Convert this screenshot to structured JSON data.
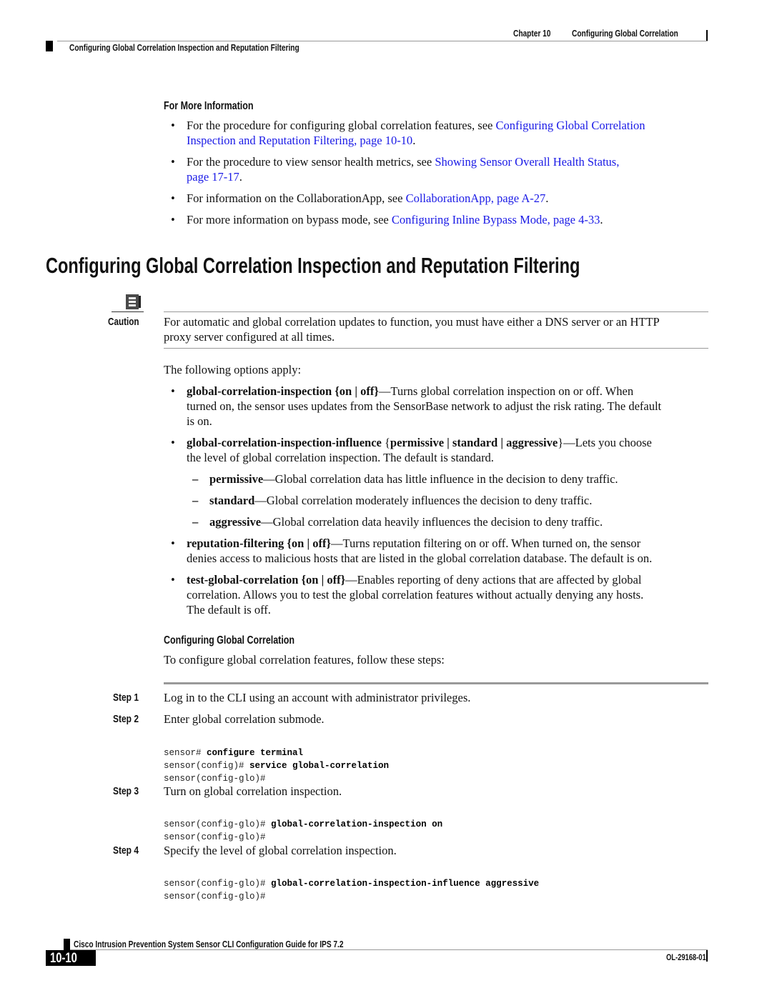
{
  "header": {
    "chapter_label": "Chapter 10",
    "chapter_title": "Configuring Global Correlation",
    "section_title": "Configuring Global Correlation Inspection and Reputation Filtering"
  },
  "more_info": {
    "heading": "For More Information",
    "items": [
      {
        "text": "For the procedure for configuring global correlation features, see ",
        "link": "Configuring Global Correlation Inspection and Reputation Filtering, page 10-10",
        "link_line1": "Configuring Global Correlation",
        "link_line2": "Inspection and Reputation Filtering, page 10-10",
        "after": "."
      },
      {
        "text": "For the procedure to view sensor health metrics, see ",
        "link": "Showing Sensor Overall Health Status, page 17-17",
        "link_line1": "Showing Sensor Overall Health Status,",
        "link_line2": "page 17-17",
        "after": "."
      },
      {
        "text": "For information on the CollaborationApp, see ",
        "link": "CollaborationApp, page A-27",
        "after": "."
      },
      {
        "text": "For more information on bypass mode, see ",
        "link": "Configuring Inline Bypass Mode, page 4-33",
        "after": "."
      }
    ]
  },
  "main_heading": "Configuring Global Correlation Inspection and Reputation Filtering",
  "caution": {
    "label": "Caution",
    "icon": "caution-book-icon",
    "line1": "For automatic and global correlation updates to function, you must have either a DNS server or an HTTP",
    "line2": "proxy server configured at all times."
  },
  "options": {
    "intro": "The following options apply:",
    "items": [
      {
        "cmd": "global-correlation-inspection {on | off}",
        "line1": "—Turns global correlation inspection on or off. When",
        "line2": "turned on, the sensor uses updates from the SensorBase network to adjust the risk rating. The default",
        "line3": "is on."
      },
      {
        "cmd": "global-correlation-inspection-influence",
        "args_open": " {",
        "args": "permissive | standard | aggressive",
        "args_close": "}",
        "line1": "—Lets you choose",
        "line2": "the level of global correlation inspection. The default is standard.",
        "sub": [
          {
            "kw": "permissive",
            "text": "—Global correlation data has little influence in the decision to deny traffic."
          },
          {
            "kw": "standard",
            "text": "—Global correlation moderately influences the decision to deny traffic."
          },
          {
            "kw": "aggressive",
            "text": "—Global correlation data heavily influences the decision to deny traffic."
          }
        ]
      },
      {
        "cmd": "reputation-filtering {on | off}",
        "line1": "—Turns reputation filtering on or off. When turned on, the sensor",
        "line2": "denies access to malicious hosts that are listed in the global correlation database. The default is on."
      },
      {
        "cmd": "test-global-correlation {on | off}",
        "line1": "—Enables reporting of deny actions that are affected by global",
        "line2": "correlation. Allows you to test the global correlation features without actually denying any hosts.",
        "line3": "The default is off."
      }
    ]
  },
  "procedure": {
    "heading": "Configuring Global Correlation",
    "intro": "To configure global correlation features, follow these steps:",
    "steps": [
      {
        "label": "Step 1",
        "text": "Log in to the CLI using an account with administrator privileges.",
        "code": []
      },
      {
        "label": "Step 2",
        "text": "Enter global correlation submode.",
        "code": [
          {
            "prompt": "sensor# ",
            "cmd": "configure terminal"
          },
          {
            "prompt": "sensor(config)# ",
            "cmd": "service global-correlation"
          },
          {
            "prompt": "sensor(config-glo)#",
            "cmd": ""
          }
        ]
      },
      {
        "label": "Step 3",
        "text": "Turn on global correlation inspection.",
        "code": [
          {
            "prompt": "sensor(config-glo)# ",
            "cmd": "global-correlation-inspection on"
          },
          {
            "prompt": "sensor(config-glo)#",
            "cmd": ""
          }
        ]
      },
      {
        "label": "Step 4",
        "text": "Specify the level of global correlation inspection.",
        "code": [
          {
            "prompt": "sensor(config-glo)# ",
            "cmd": "global-correlation-inspection-influence aggressive"
          },
          {
            "prompt": "sensor(config-glo)#",
            "cmd": ""
          }
        ]
      }
    ]
  },
  "footer": {
    "guide_title": "Cisco Intrusion Prevention System Sensor CLI Configuration Guide for IPS 7.2",
    "page_number": "10-10",
    "doc_id": "OL-29168-01"
  }
}
